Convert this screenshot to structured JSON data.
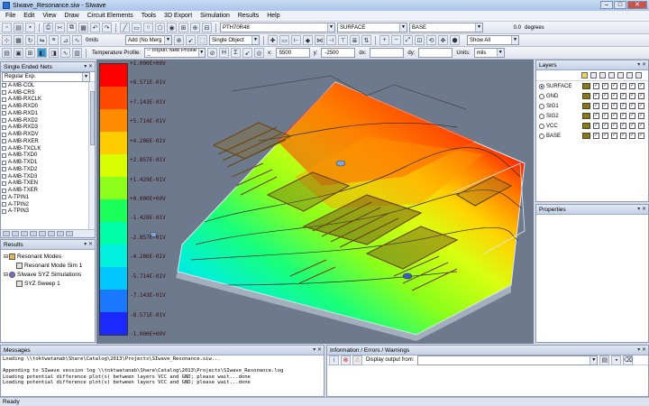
{
  "window": {
    "title": "SIwave_Resonance.siw - SIwave"
  },
  "menu": [
    "File",
    "Edit",
    "View",
    "Draw",
    "Circuit Elements",
    "Tools",
    "3D Export",
    "Simulation",
    "Results",
    "Help"
  ],
  "toolbar1": {
    "part_combo": "PTH70R48",
    "layer_from": "SURFACE",
    "layer_to": "BASE",
    "angle_value": "0.0",
    "angle_unit": "degrees"
  },
  "toolbar2": {
    "width_value": "0mils",
    "add_mode": "Add (No Merg",
    "select_mode": "Single Object",
    "show_filter": "Show All"
  },
  "toolbar3": {
    "temperature_label": "Temperature Profile:",
    "temperature_value": "-- Import New Profile --",
    "x_label": "x:",
    "x_value": "5500",
    "y_label": "y:",
    "y_value": "-2500",
    "dx_label": "dx:",
    "dy_label": "dy:",
    "units_label": "Units:",
    "units_value": "mils"
  },
  "nets_panel": {
    "title": "Single Ended Nets",
    "filter": "Regular Exp.",
    "nets": [
      "A-MB-COL",
      "A-MB-CRS",
      "A-MB-RXCLK",
      "A-MB-RXD0",
      "A-MB-RXD1",
      "A-MB-RXD2",
      "A-MB-RXD3",
      "A-MB-RXDV",
      "A-MB-RXER",
      "A-MB-TXCLK",
      "A-MB-TXD0",
      "A-MB-TXD1",
      "A-MB-TXD2",
      "A-MB-TXD3",
      "A-MB-TXEN",
      "A-MB-TXER",
      "A-TPIN1",
      "A-TPIN2",
      "A-TPIN3"
    ]
  },
  "results_panel": {
    "title": "Results",
    "items": [
      {
        "label": "Resonant Modes",
        "level": 0
      },
      {
        "label": "Resonant Mode Sim 1",
        "level": 1
      },
      {
        "label": "SIwave SYZ Simulations",
        "level": 0
      },
      {
        "label": "SYZ Sweep 1",
        "level": 1
      }
    ]
  },
  "legend": {
    "colors": [
      "#ff0000",
      "#ff4a00",
      "#ff8c00",
      "#ffcc00",
      "#d8ff00",
      "#8cff1a",
      "#1aff5a",
      "#00ffa8",
      "#00f0e0",
      "#00c8ff",
      "#1a78ff",
      "#1a2aff"
    ],
    "labels": [
      "+1.000E+00V",
      "+8.571E-01V",
      "+7.143E-01V",
      "+5.714E-01V",
      "+4.286E-01V",
      "+2.857E-01V",
      "+1.429E-01V",
      "+0.000E+00V",
      "-1.429E-01V",
      "-2.857E-01V",
      "-4.286E-01V",
      "-5.714E-01V",
      "-7.143E-01V",
      "-8.571E-01V",
      "-1.000E+00V"
    ]
  },
  "layers_panel": {
    "title": "Layers",
    "layers": [
      {
        "name": "SURFACE",
        "selected": true
      },
      {
        "name": "GND",
        "selected": false
      },
      {
        "name": "SIG1",
        "selected": false
      },
      {
        "name": "SIG2",
        "selected": false
      },
      {
        "name": "VCC",
        "selected": false
      },
      {
        "name": "BASE",
        "selected": false
      }
    ]
  },
  "properties_panel": {
    "title": "Properties"
  },
  "messages_panel": {
    "title": "Messages",
    "lines": [
      "Loading \\\\toktwatanab\\Share\\Catalog\\2013\\Projects\\SIwave_Resonance.siw...",
      "",
      "Appending to SIwave session log \\\\toktwatanab\\Share\\Catalog\\2013\\Projects\\SIwave_Resonance.log",
      "Loading potential difference plot(s) between layers VCC and GND; please wait...done",
      "Loading potential difference plot(s) between layers VCC and GND; please wait...done"
    ]
  },
  "info_panel": {
    "title": "Information / Errors / Warnings",
    "display_label": "Display output from:"
  },
  "status": "Ready"
}
